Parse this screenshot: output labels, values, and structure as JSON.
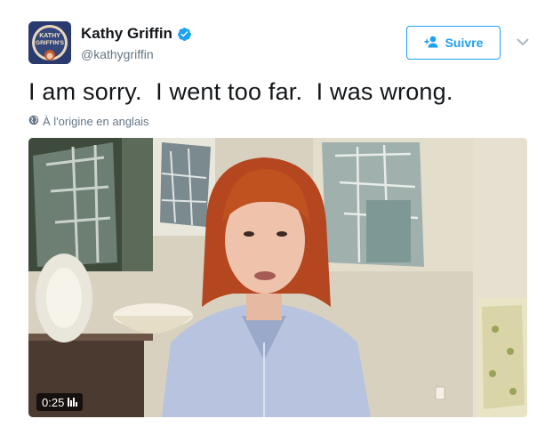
{
  "user": {
    "name": "Kathy Griffin",
    "handle": "@kathygriffin",
    "verified": true,
    "avatar_text": "KATHY GRIFFIN'S"
  },
  "follow": {
    "label": "Suivre",
    "icon": "add-user-icon"
  },
  "menu": {
    "icon": "chevron-down-icon"
  },
  "tweet": {
    "text": "I am sorry.  I went too far.  I was wrong.",
    "translation_note": "À l'origine en anglais",
    "translation_icon": "globe-icon"
  },
  "video": {
    "duration": "0:25",
    "duration_icon": "volume-bars-icon"
  },
  "colors": {
    "accent": "#1da1f2",
    "text": "#14171a",
    "secondary": "#657786"
  }
}
